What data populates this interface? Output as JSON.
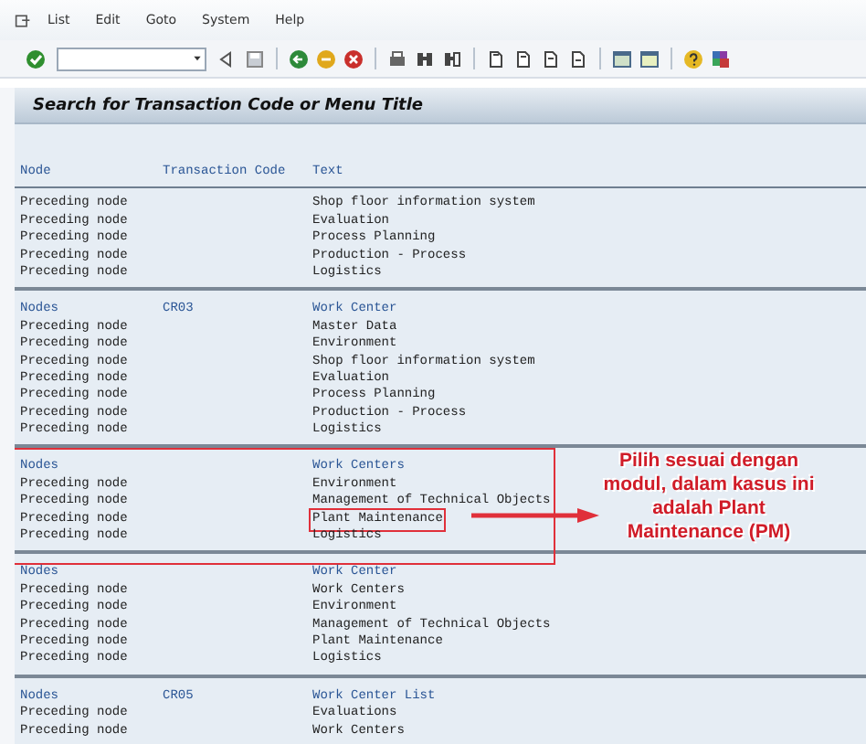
{
  "menu": [
    "List",
    "Edit",
    "Goto",
    "System",
    "Help"
  ],
  "title": "Search for Transaction Code or Menu Title",
  "columns": [
    "Node",
    "Transaction Code",
    "Text"
  ],
  "groups": [
    {
      "highlighted": false,
      "rows": [
        {
          "kind": "child",
          "node": "Preceding node",
          "text": "Shop floor information system",
          "highlighted": false
        },
        {
          "kind": "child",
          "node": "Preceding node",
          "text": "Evaluation",
          "highlighted": false
        },
        {
          "kind": "child",
          "node": "Preceding node",
          "text": "Process Planning",
          "highlighted": false
        },
        {
          "kind": "child",
          "node": "Preceding node",
          "text": "Production - Process",
          "highlighted": false
        },
        {
          "kind": "child",
          "node": "Preceding node",
          "text": "Logistics",
          "highlighted": false
        }
      ]
    },
    {
      "highlighted": false,
      "rows": [
        {
          "kind": "header",
          "node": "Nodes",
          "code": "CR03",
          "text": "Work Center",
          "highlighted": false
        },
        {
          "kind": "child",
          "node": "Preceding node",
          "text": "Master Data",
          "highlighted": false
        },
        {
          "kind": "child",
          "node": "Preceding node",
          "text": "Environment",
          "highlighted": false
        },
        {
          "kind": "child",
          "node": "Preceding node",
          "text": "Shop floor information system",
          "highlighted": false
        },
        {
          "kind": "child",
          "node": "Preceding node",
          "text": "Evaluation",
          "highlighted": false
        },
        {
          "kind": "child",
          "node": "Preceding node",
          "text": "Process Planning",
          "highlighted": false
        },
        {
          "kind": "child",
          "node": "Preceding node",
          "text": "Production - Process",
          "highlighted": false
        },
        {
          "kind": "child",
          "node": "Preceding node",
          "text": "Logistics",
          "highlighted": false
        }
      ]
    },
    {
      "highlighted": true,
      "rows": [
        {
          "kind": "header",
          "node": "Nodes",
          "text": "Work Centers",
          "highlighted": false
        },
        {
          "kind": "child",
          "node": "Preceding node",
          "text": "Environment",
          "highlighted": false
        },
        {
          "kind": "child",
          "node": "Preceding node",
          "text": "Management of Technical Objects",
          "highlighted": false
        },
        {
          "kind": "child",
          "node": "Preceding node",
          "text": "Plant Maintenance",
          "highlighted": true
        },
        {
          "kind": "child",
          "node": "Preceding node",
          "text": "Logistics",
          "highlighted": false
        }
      ]
    },
    {
      "highlighted": false,
      "rows": [
        {
          "kind": "header",
          "node": "Nodes",
          "text": "Work Center",
          "highlighted": false
        },
        {
          "kind": "child",
          "node": "Preceding node",
          "text": "Work Centers",
          "highlighted": false
        },
        {
          "kind": "child",
          "node": "Preceding node",
          "text": "Environment",
          "highlighted": false
        },
        {
          "kind": "child",
          "node": "Preceding node",
          "text": "Management of Technical Objects",
          "highlighted": false
        },
        {
          "kind": "child",
          "node": "Preceding node",
          "text": "Plant Maintenance",
          "highlighted": false
        },
        {
          "kind": "child",
          "node": "Preceding node",
          "text": "Logistics",
          "highlighted": false
        }
      ]
    },
    {
      "highlighted": false,
      "rows": [
        {
          "kind": "header",
          "node": "Nodes",
          "code": "CR05",
          "text": "Work Center List",
          "highlighted": false
        },
        {
          "kind": "child",
          "node": "Preceding node",
          "text": "Evaluations",
          "highlighted": false
        },
        {
          "kind": "child",
          "node": "Preceding node",
          "text": "Work Centers",
          "highlighted": false
        }
      ]
    }
  ],
  "callout": "Pilih sesuai dengan modul, dalam kasus ini adalah Plant Maintenance (PM)"
}
